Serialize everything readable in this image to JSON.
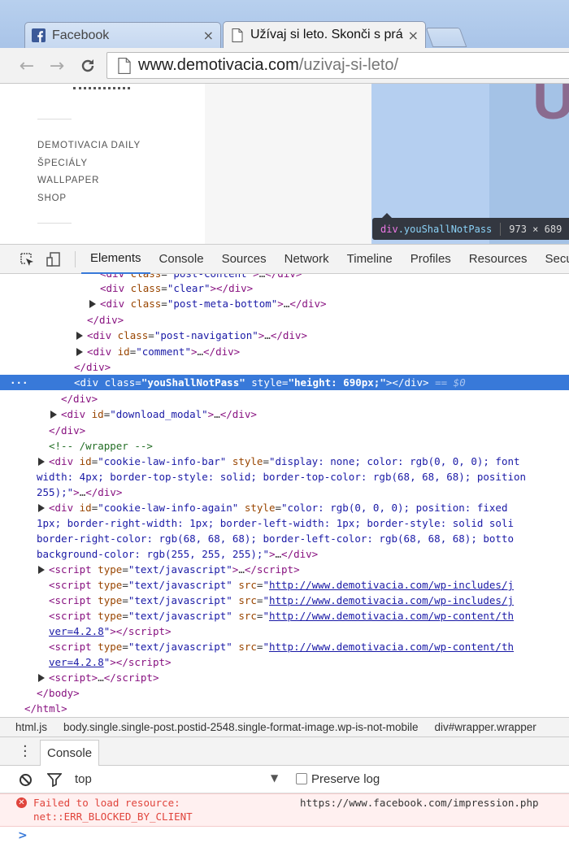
{
  "browser": {
    "tabs": [
      {
        "title": "Facebook",
        "active": false,
        "close": "×"
      },
      {
        "title": "Užívaj si leto. Skonči s prá",
        "active": true,
        "close": "×"
      }
    ],
    "nav": {
      "back": "←",
      "forward": "→",
      "reload": "C"
    },
    "address": {
      "host": "www.demotivacia.com",
      "path": "/uzivaj-si-leto/"
    }
  },
  "page": {
    "menu": [
      "DEMOTIVACIA DAILY",
      "ŠPECIÁLY",
      "WALLPAPER",
      "SHOP"
    ],
    "hero_glyph": "U",
    "inspect_tooltip": {
      "tag": "div",
      "class": ".youShallNotPass",
      "size": "973 × 689"
    }
  },
  "devtools": {
    "tabs": [
      "Elements",
      "Console",
      "Sources",
      "Network",
      "Timeline",
      "Profiles",
      "Resources",
      "Secu"
    ],
    "selected_tab": "Elements",
    "breadcrumbs": [
      "html.js",
      "body.single.single-post.postid-2548.single-format-image.wp-is-not-mobile",
      "div#wrapper.wrapper"
    ],
    "console": {
      "tab": "Console",
      "context": "top",
      "preserve_log": "Preserve log",
      "error_message_line1": "Failed to load resource:",
      "error_message_line2": "net::ERR_BLOCKED_BY_CLIENT",
      "error_source": "https://www.facebook.com/impression.php",
      "prompt": ">"
    }
  }
}
